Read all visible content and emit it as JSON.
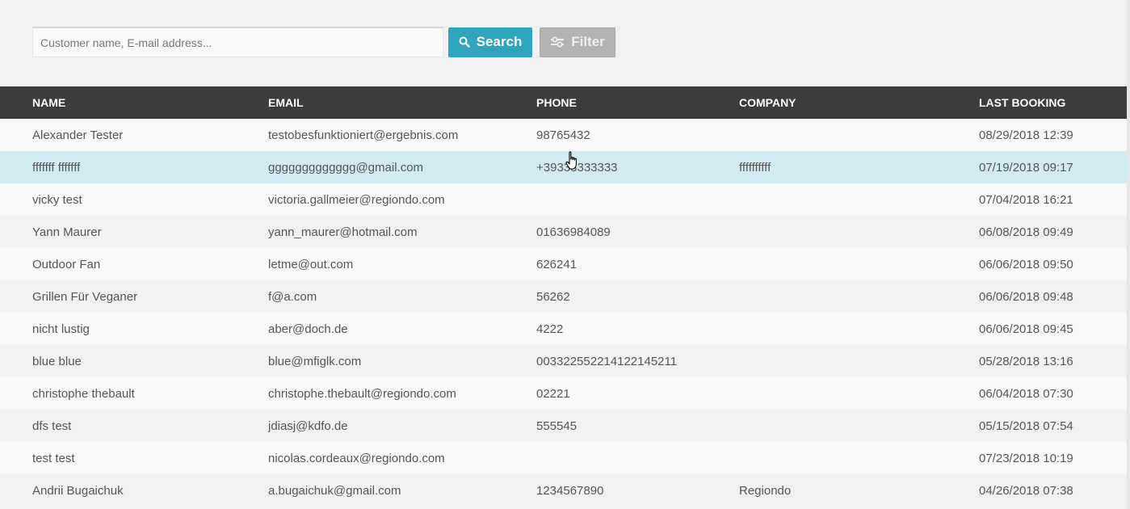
{
  "search": {
    "placeholder": "Customer name, E-mail address...",
    "search_label": "Search",
    "filter_label": "Filter"
  },
  "colors": {
    "accent": "#2ea5bd",
    "header_bg": "#3b3c3e",
    "hover_row": "#d2ebf0"
  },
  "table": {
    "headers": {
      "name": "NAME",
      "email": "EMAIL",
      "phone": "PHONE",
      "company": "COMPANY",
      "last_booking": "LAST BOOKING"
    },
    "rows": [
      {
        "name": "Alexander Tester",
        "email": "testobesfunktioniert@ergebnis.com",
        "phone": "98765432",
        "company": "",
        "last_booking": "08/29/2018 12:39"
      },
      {
        "name": "fffffff fffffff",
        "email": "ggggggggggggg@gmail.com",
        "phone": "+39333333333",
        "company": "ffffffffff",
        "last_booking": "07/19/2018 09:17"
      },
      {
        "name": "vicky test",
        "email": "victoria.gallmeier@regiondo.com",
        "phone": "",
        "company": "",
        "last_booking": "07/04/2018 16:21"
      },
      {
        "name": "Yann Maurer",
        "email": "yann_maurer@hotmail.com",
        "phone": "01636984089",
        "company": "",
        "last_booking": "06/08/2018 09:49"
      },
      {
        "name": "Outdoor Fan",
        "email": "letme@out.com",
        "phone": "626241",
        "company": "",
        "last_booking": "06/06/2018 09:50"
      },
      {
        "name": "Grillen Für Veganer",
        "email": "f@a.com",
        "phone": "56262",
        "company": "",
        "last_booking": "06/06/2018 09:48"
      },
      {
        "name": "nicht lustig",
        "email": "aber@doch.de",
        "phone": "4222",
        "company": "",
        "last_booking": "06/06/2018 09:45"
      },
      {
        "name": "blue blue",
        "email": "blue@mfiglk.com",
        "phone": "003322552214122145211",
        "company": "",
        "last_booking": "05/28/2018 13:16"
      },
      {
        "name": "christophe thebault",
        "email": "christophe.thebault@regiondo.com",
        "phone": "02221",
        "company": "",
        "last_booking": "06/04/2018 07:30"
      },
      {
        "name": "dfs test",
        "email": "jdiasj@kdfo.de",
        "phone": "555545",
        "company": "",
        "last_booking": "05/15/2018 07:54"
      },
      {
        "name": "test test",
        "email": "nicolas.cordeaux@regiondo.com",
        "phone": "",
        "company": "",
        "last_booking": "07/23/2018 10:19"
      },
      {
        "name": "Andrii Bugaichuk",
        "email": "a.bugaichuk@gmail.com",
        "phone": "1234567890",
        "company": "Regiondo",
        "last_booking": "04/26/2018 07:38"
      }
    ]
  }
}
